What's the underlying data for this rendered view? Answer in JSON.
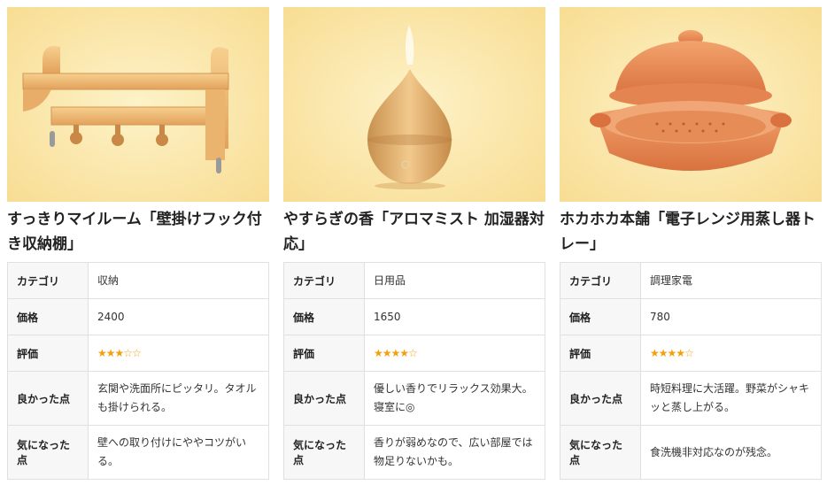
{
  "labels": {
    "category": "カテゴリ",
    "price": "価格",
    "rating": "評価",
    "good": "良かった点",
    "concern": "気になった点"
  },
  "products": [
    {
      "title": "すっきりマイルーム「壁掛けフック付き収納棚」",
      "category": "収納",
      "price": "2400",
      "rating": 3.5,
      "stars": "★★★☆☆",
      "good": "玄関や洗面所にピッタリ。タオルも掛けられる。",
      "concern": "壁への取り付けにややコツがいる。"
    },
    {
      "title": "やすらぎの香「アロマミスト 加湿器対応」",
      "category": "日用品",
      "price": "1650",
      "rating": 4,
      "stars": "★★★★☆",
      "good": "優しい香りでリラックス効果大。寝室に◎",
      "concern": "香りが弱めなので、広い部屋では物足りないかも。"
    },
    {
      "title": "ホカホカ本舗「電子レンジ用蒸し器トレー」",
      "category": "調理家電",
      "price": "780",
      "rating": 4,
      "stars": "★★★★☆",
      "good": "時短料理に大活躍。野菜がシャキッと蒸し上がる。",
      "concern": "食洗機非対応なのが残念。"
    }
  ],
  "colors": {
    "star": "#f3a10b",
    "image_bg": "#fbe9b3"
  }
}
